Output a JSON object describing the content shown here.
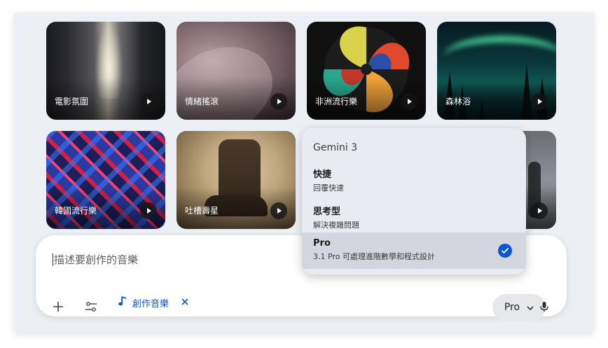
{
  "tiles": [
    {
      "label": "電影氛圍"
    },
    {
      "label": "情緒搖滾"
    },
    {
      "label": "非洲流行樂"
    },
    {
      "label": "森林浴"
    },
    {
      "label": "韓國流行樂"
    },
    {
      "label": "吐槽壽星"
    }
  ],
  "composer": {
    "placeholder": "描述要創作的音樂",
    "chip_label": "創作音樂",
    "model_button": "Pro"
  },
  "model_menu": {
    "heading": "Gemini 3",
    "options": [
      {
        "title": "快捷",
        "subtitle": "回覆快速",
        "selected": false
      },
      {
        "title": "思考型",
        "subtitle": "解決複雜問題",
        "selected": false
      },
      {
        "title": "Pro",
        "subtitle": "3.1 Pro 可處理進階數學和程式設計",
        "selected": true
      }
    ]
  },
  "colors": {
    "accent": "#0b57d0",
    "page_bg": "#eceff4",
    "menu_bg": "#e8ebf2",
    "selected_row": "#d3d6de"
  },
  "icons": [
    "plus-icon",
    "tune-icon",
    "music-note-icon",
    "close-icon",
    "chevron-down-icon",
    "microphone-icon",
    "check-icon",
    "play-icon"
  ]
}
